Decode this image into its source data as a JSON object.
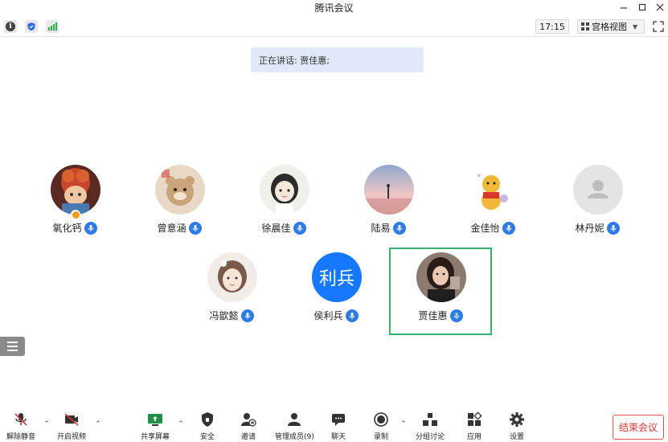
{
  "window": {
    "title": "腾讯会议"
  },
  "topbar": {
    "time": "17:15",
    "view_label": "宫格视图"
  },
  "speaking": {
    "text": "正在讲话: 贾佳惠;"
  },
  "participants": [
    {
      "name": "氧化钙",
      "host": true
    },
    {
      "name": "曾意涵"
    },
    {
      "name": "徐晨佳"
    },
    {
      "name": "陆易"
    },
    {
      "name": "金佳怡"
    },
    {
      "name": "林丹妮"
    },
    {
      "name": "冯歆懿"
    },
    {
      "name": "侯利兵",
      "initials": "利兵"
    },
    {
      "name": "贾佳惠",
      "active_speaker": true
    }
  ],
  "toolbar": {
    "unmute": "解除静音",
    "video": "开启视频",
    "share": "共享屏幕",
    "security": "安全",
    "invite": "邀请",
    "members": "管理成员(9)",
    "chat": "聊天",
    "record": "录制",
    "breakout": "分组讨论",
    "apps": "应用",
    "settings": "设置",
    "end": "结束会议"
  },
  "colors": {
    "accent": "#2f7be5",
    "active_frame": "#34b56b",
    "end_red": "#d93636",
    "banner": "#dfe9f7"
  }
}
